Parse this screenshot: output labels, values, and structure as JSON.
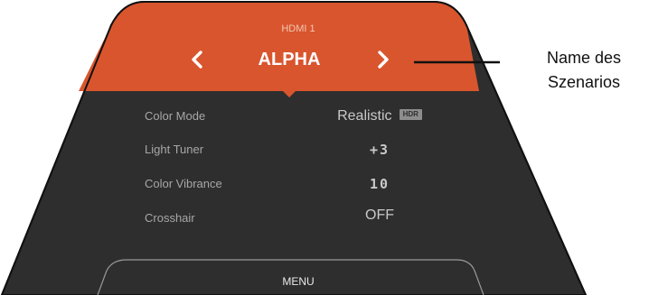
{
  "colors": {
    "panel": "#2e2e2e",
    "header": "#d9552e",
    "outline": "#111111",
    "label": "#a7a7a7",
    "value": "#c9c9c9"
  },
  "header": {
    "source": "HDMI 1",
    "scenario_name": "ALPHA",
    "prev_icon": "chevron-left-icon",
    "next_icon": "chevron-right-icon"
  },
  "settings": [
    {
      "label": "Color Mode",
      "value": "Realistic",
      "badge": "HDR"
    },
    {
      "label": "Light Tuner",
      "value": "+3"
    },
    {
      "label": "Color Vibrance",
      "value": "10"
    },
    {
      "label": "Crosshair",
      "value": "OFF"
    }
  ],
  "footer": {
    "menu_label": "MENU"
  },
  "callout": {
    "line1": "Name des",
    "line2": "Szenarios"
  }
}
